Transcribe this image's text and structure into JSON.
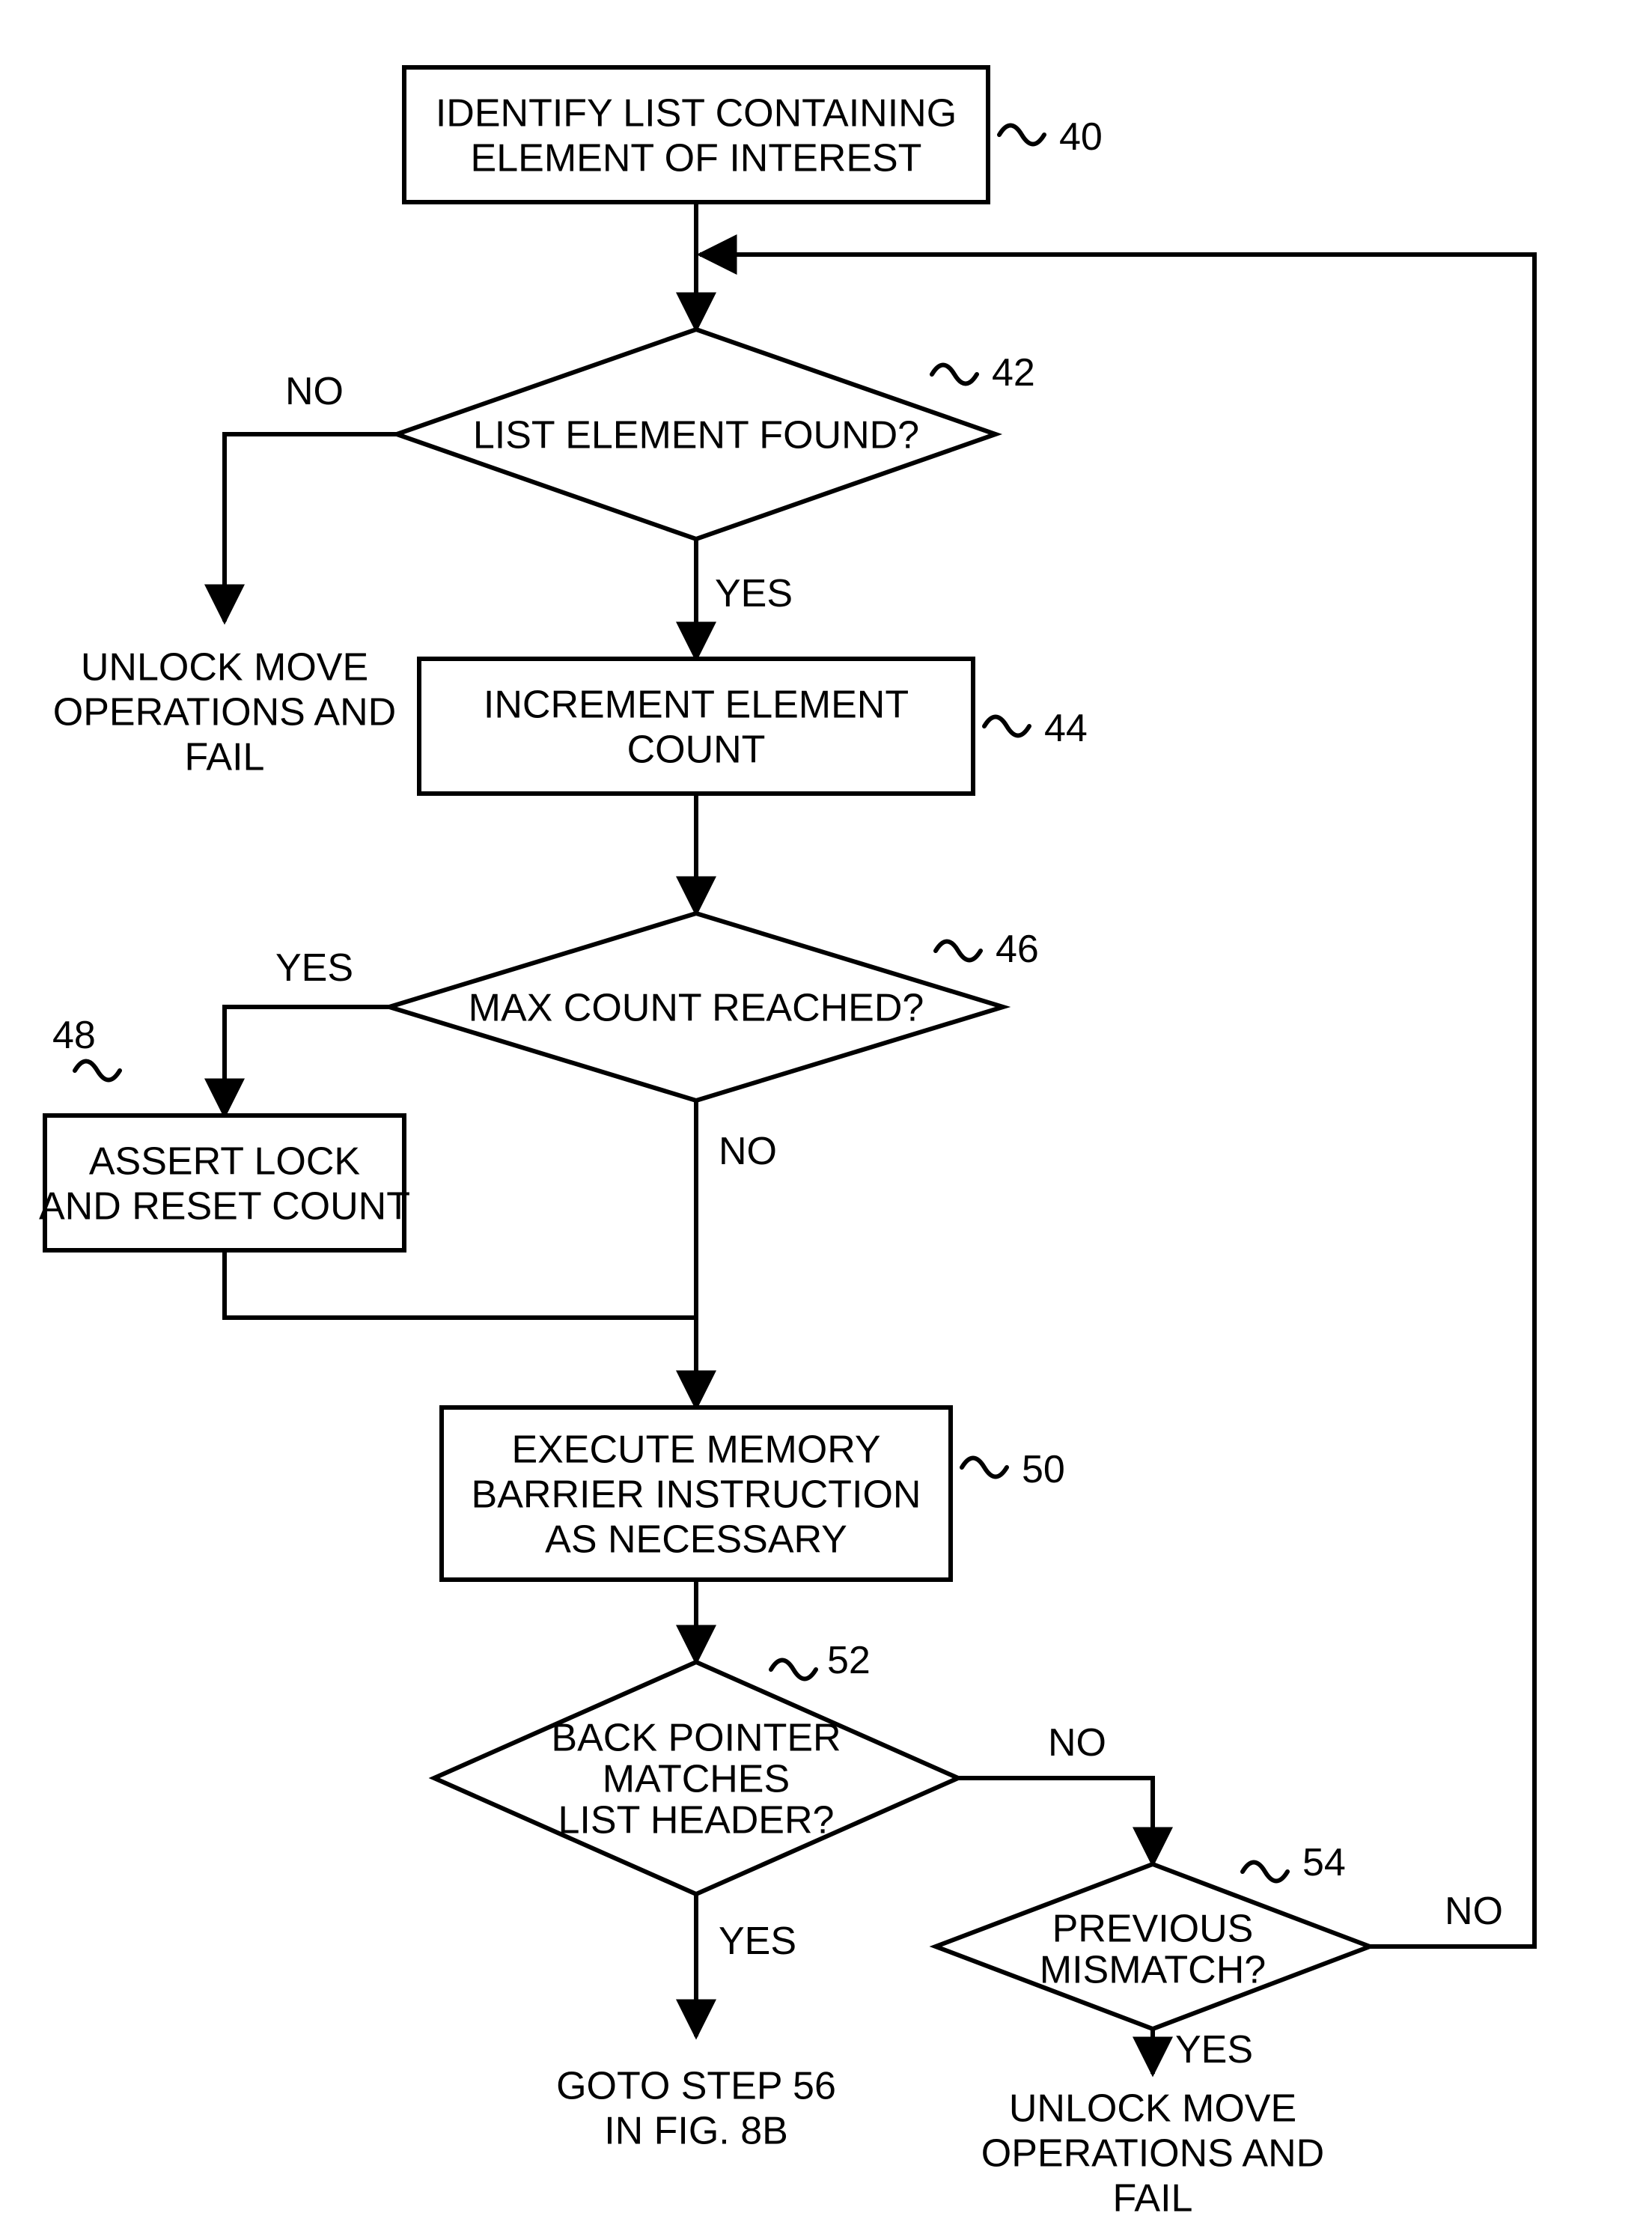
{
  "nodes": {
    "n40": {
      "ref": "40",
      "lines": [
        "IDENTIFY LIST CONTAINING",
        "ELEMENT OF INTEREST"
      ]
    },
    "n42": {
      "ref": "42",
      "lines": [
        "LIST ELEMENT FOUND?"
      ]
    },
    "n44": {
      "ref": "44",
      "lines": [
        "INCREMENT ELEMENT",
        "COUNT"
      ]
    },
    "n46": {
      "ref": "46",
      "lines": [
        "MAX COUNT REACHED?"
      ]
    },
    "n48": {
      "ref": "48",
      "lines": [
        "ASSERT LOCK",
        "AND RESET COUNT"
      ]
    },
    "n50": {
      "ref": "50",
      "lines": [
        "EXECUTE MEMORY",
        "BARRIER INSTRUCTION",
        "AS NECESSARY"
      ]
    },
    "n52": {
      "ref": "52",
      "lines": [
        "BACK POINTER",
        "MATCHES",
        "LIST HEADER?"
      ]
    },
    "n54": {
      "ref": "54",
      "lines": [
        "PREVIOUS",
        "MISMATCH?"
      ]
    }
  },
  "terminals": {
    "t_fail_left": {
      "lines": [
        "UNLOCK MOVE",
        "OPERATIONS AND",
        "FAIL"
      ]
    },
    "t_goto": {
      "lines": [
        "GOTO STEP 56",
        "IN FIG. 8B"
      ]
    },
    "t_fail_right": {
      "lines": [
        "UNLOCK MOVE",
        "OPERATIONS AND",
        "FAIL"
      ]
    }
  },
  "edge_labels": {
    "e42_no": "NO",
    "e42_yes": "YES",
    "e46_yes": "YES",
    "e46_no": "NO",
    "e52_yes": "YES",
    "e52_no": "NO",
    "e54_yes": "YES",
    "e54_no": "NO"
  }
}
